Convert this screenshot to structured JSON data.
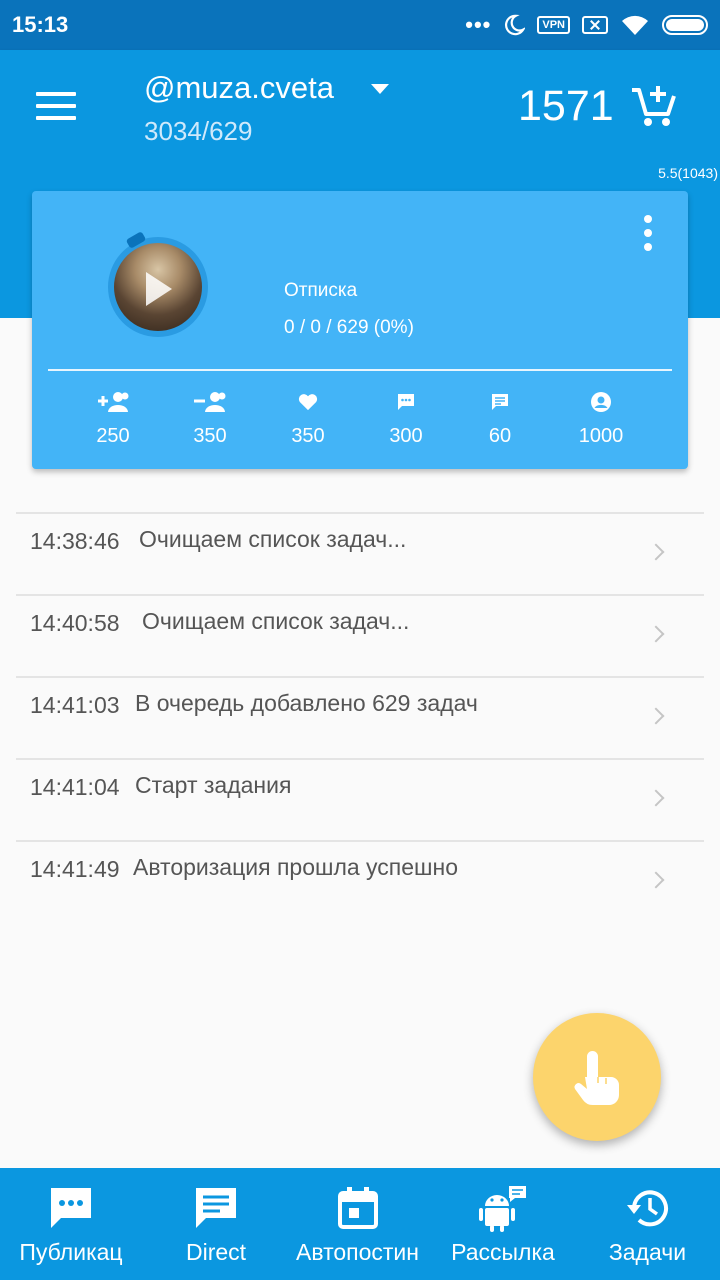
{
  "status_bar": {
    "time": "15:13",
    "dots": "•••",
    "vpn_label": "VPN"
  },
  "app_bar": {
    "account_name": "@muza.cveta",
    "account_stats": "3034/629",
    "balance": "1571"
  },
  "version": "5.5(1043)",
  "card": {
    "task_title": "Отписка",
    "task_progress": "0 / 0 / 629 (0%)",
    "stats": [
      {
        "icon": "add-user-icon",
        "value": "250"
      },
      {
        "icon": "remove-user-icon",
        "value": "350"
      },
      {
        "icon": "heart-icon",
        "value": "350"
      },
      {
        "icon": "comment-icon",
        "value": "300"
      },
      {
        "icon": "message-icon",
        "value": "60"
      },
      {
        "icon": "profile-icon",
        "value": "1000"
      }
    ]
  },
  "log": [
    {
      "time": "14:38:46",
      "message": "Очищаем список задач..."
    },
    {
      "time": "14:40:58",
      "message": "Очищаем список задач..."
    },
    {
      "time": "14:41:03",
      "message": "В очередь добавлено 629 задач"
    },
    {
      "time": "14:41:04",
      "message": "Старт задания"
    },
    {
      "time": "14:41:49",
      "message": "Авторизация прошла успешно"
    }
  ],
  "bottom_nav": [
    {
      "label": "Публикац",
      "icon": "chat-bubble-icon"
    },
    {
      "label": "Direct",
      "icon": "message-icon"
    },
    {
      "label": "Автопостин",
      "icon": "calendar-icon"
    },
    {
      "label": "Рассылка",
      "icon": "android-icon"
    },
    {
      "label": "Задачи",
      "icon": "history-icon"
    }
  ],
  "colors": {
    "primary": "#0b97e0",
    "status_bar": "#0a73bb",
    "card": "#43b4f7",
    "fab": "#fcd46c"
  }
}
